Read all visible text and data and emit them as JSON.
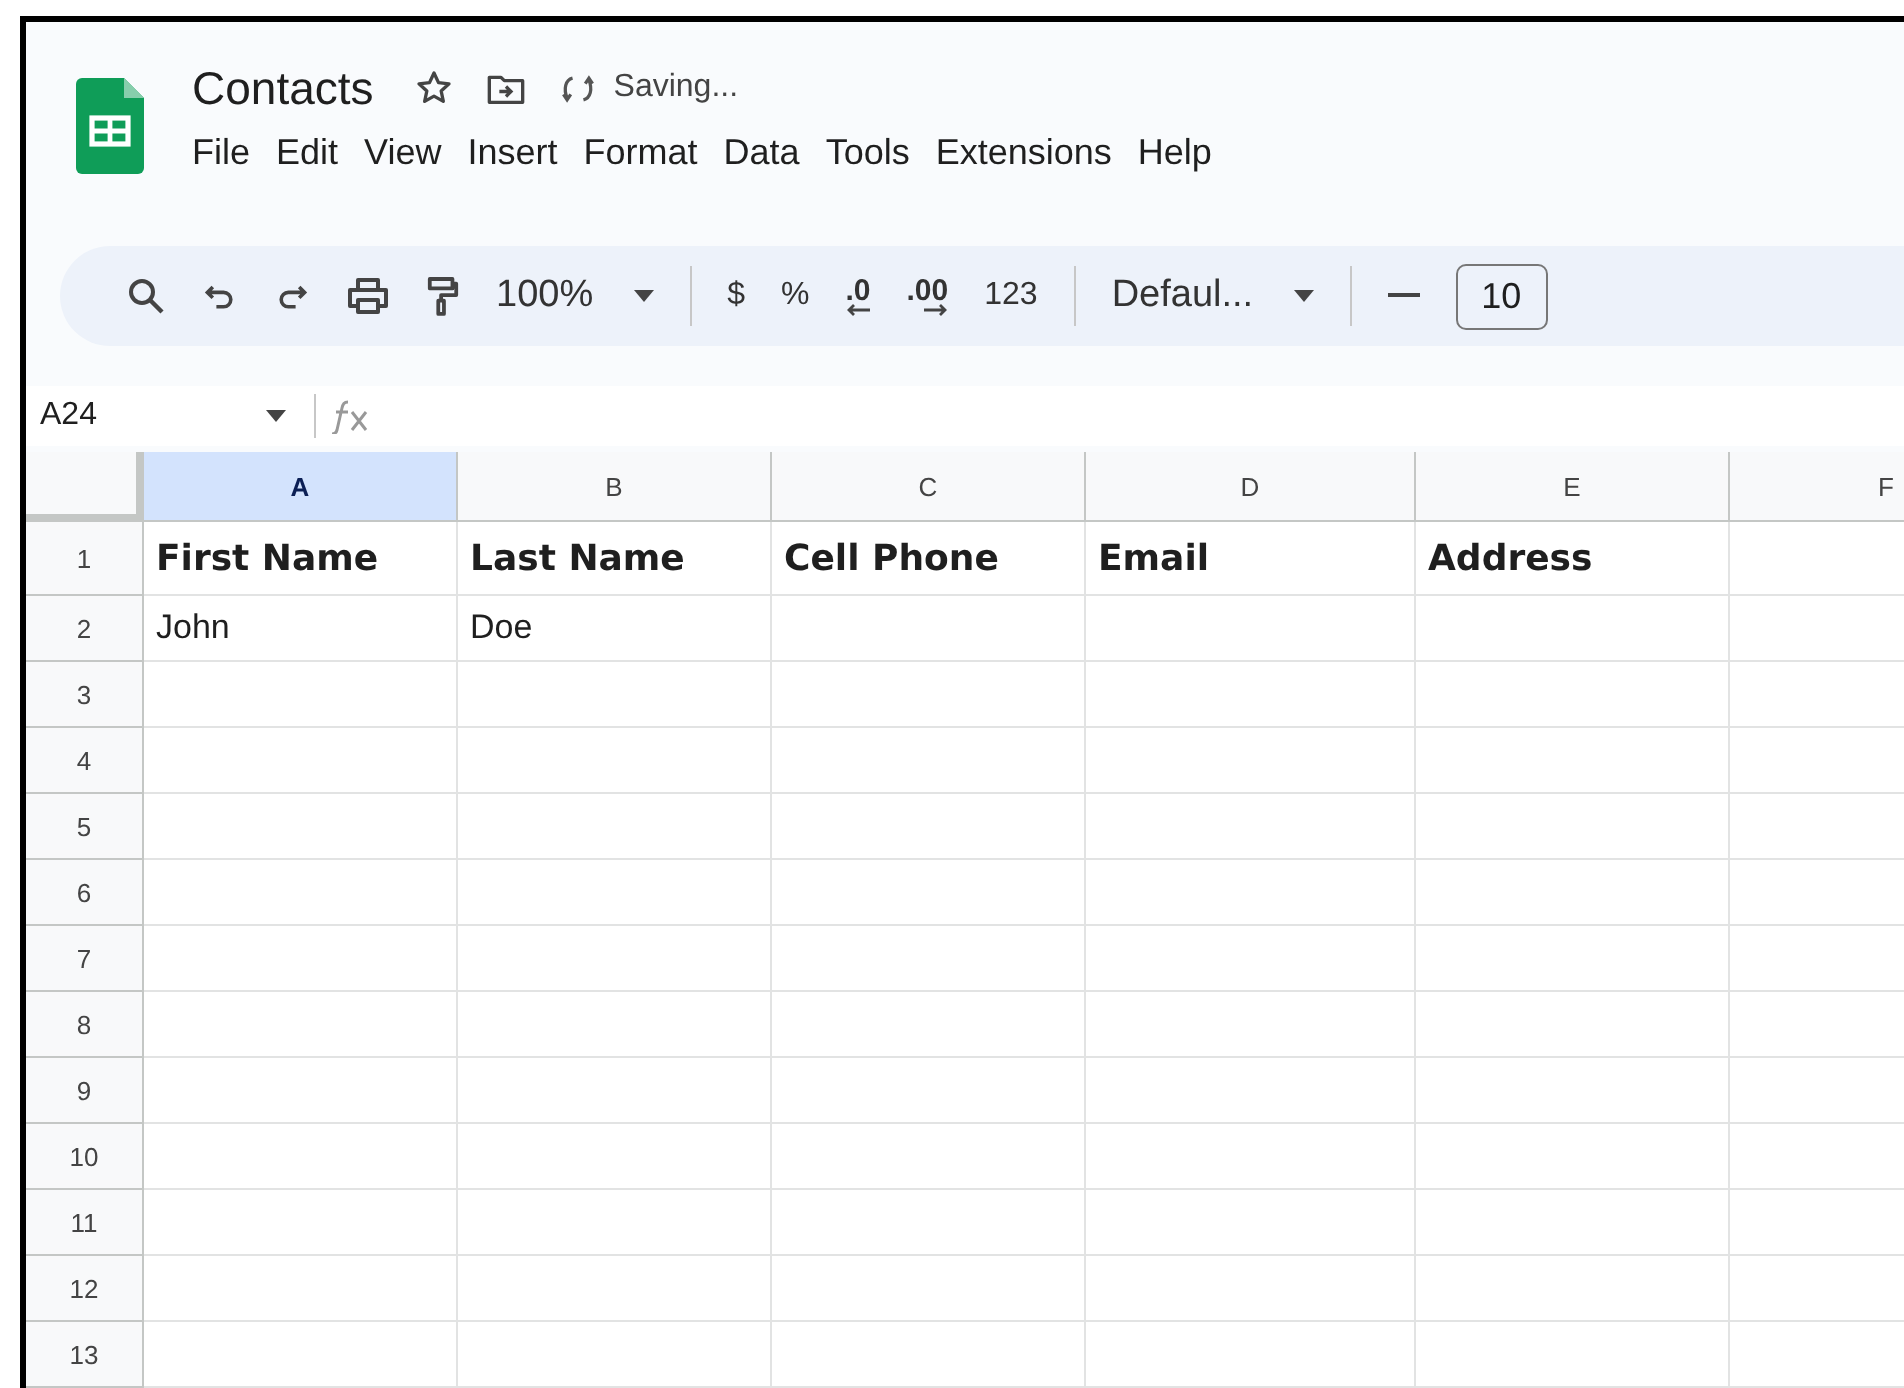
{
  "document": {
    "title": "Contacts",
    "status": "Saving..."
  },
  "menu": [
    "File",
    "Edit",
    "View",
    "Insert",
    "Format",
    "Data",
    "Tools",
    "Extensions",
    "Help"
  ],
  "toolbar": [
    {
      "kind": "search"
    },
    {
      "kind": "undo"
    },
    {
      "kind": "redo"
    },
    {
      "kind": "print"
    },
    {
      "kind": "paint"
    },
    {
      "kind": "dropdown",
      "label": "100%"
    },
    {
      "kind": "divider"
    },
    {
      "kind": "text",
      "label": "$"
    },
    {
      "kind": "text",
      "label": "%"
    },
    {
      "kind": "decrease",
      "label": ".0"
    },
    {
      "kind": "increase",
      "label": ".00"
    },
    {
      "kind": "text",
      "label": "123"
    },
    {
      "kind": "divider"
    },
    {
      "kind": "dropdown",
      "label": "Defaul..."
    },
    {
      "kind": "divider"
    },
    {
      "kind": "minus"
    },
    {
      "kind": "field",
      "label": "10"
    }
  ],
  "name_box": "A24",
  "columns": [
    {
      "label": "A",
      "selected": true
    },
    {
      "label": "B",
      "selected": false
    },
    {
      "label": "C",
      "selected": false
    },
    {
      "label": "D",
      "selected": false
    },
    {
      "label": "E",
      "selected": false
    },
    {
      "label": "F",
      "selected": false
    }
  ],
  "rows": [
    {
      "number": "1",
      "bold": true,
      "cells": [
        "First Name",
        "Last Name",
        "Cell Phone",
        "Email",
        "Address"
      ]
    },
    {
      "number": "2",
      "bold": false,
      "cells": [
        "John",
        "Doe"
      ]
    },
    {
      "number": "3",
      "cells": []
    },
    {
      "number": "4",
      "cells": []
    },
    {
      "number": "5",
      "cells": []
    },
    {
      "number": "6",
      "cells": []
    },
    {
      "number": "7",
      "cells": []
    },
    {
      "number": "8",
      "cells": []
    },
    {
      "number": "9",
      "cells": []
    },
    {
      "number": "10",
      "cells": []
    },
    {
      "number": "11",
      "cells": []
    },
    {
      "number": "12",
      "cells": []
    },
    {
      "number": "13",
      "cells": []
    }
  ]
}
